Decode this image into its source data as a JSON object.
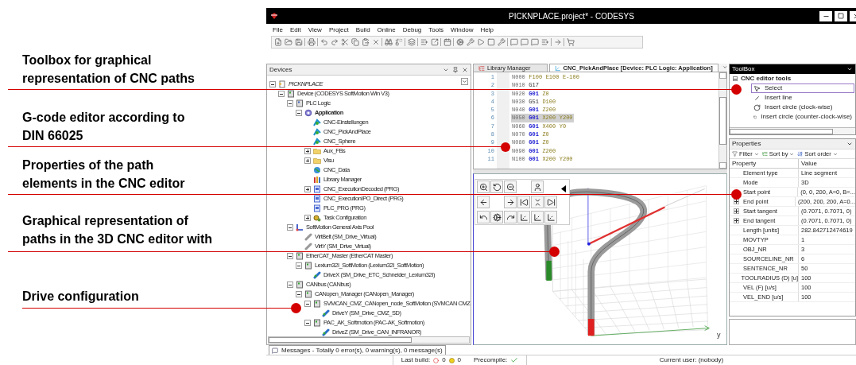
{
  "annotations": [
    {
      "text": "Toolbox for graphical\nrepresentation of CNC paths"
    },
    {
      "text": "G-code editor according to\nDIN 66025"
    },
    {
      "text": "Properties of the path\nelements in the CNC editor"
    },
    {
      "text": "Graphical representation of\npaths in the 3D CNC editor with"
    },
    {
      "text": "Drive configuration"
    }
  ],
  "window": {
    "title": "PICKNPLACE.project* - CODESYS"
  },
  "menu": [
    "File",
    "Edit",
    "View",
    "Project",
    "Build",
    "Online",
    "Debug",
    "Tools",
    "Window",
    "Help"
  ],
  "devices": {
    "title": "Devices",
    "tree": [
      {
        "label": "PICKNPLACE",
        "kind": "project",
        "italic": true,
        "expanded": true,
        "children": [
          {
            "label": "Device (CODESYS SoftMotion Win V3)",
            "kind": "device",
            "expanded": true,
            "children": [
              {
                "label": "PLC Logic",
                "kind": "plc",
                "expanded": true,
                "children": [
                  {
                    "label": "Application",
                    "kind": "app",
                    "bold": true,
                    "expanded": true,
                    "children": [
                      {
                        "label": "CNC-Einstellungen",
                        "kind": "cnc"
                      },
                      {
                        "label": "CNC_PickAndPlace",
                        "kind": "cnc"
                      },
                      {
                        "label": "CNC_Sphere",
                        "kind": "cnc"
                      },
                      {
                        "label": "Aux_FBs",
                        "kind": "folder",
                        "expanded": false
                      },
                      {
                        "label": "Visu",
                        "kind": "folder",
                        "expanded": false
                      },
                      {
                        "label": "CNC_Data",
                        "kind": "globe"
                      },
                      {
                        "label": "Library Manager",
                        "kind": "library"
                      },
                      {
                        "label": "CNC_ExecutionDecoded (PRG)",
                        "kind": "prg",
                        "expanded": false
                      },
                      {
                        "label": "CNC_ExecutionIPO_Direct (PRG)",
                        "kind": "prg"
                      },
                      {
                        "label": "PLC_PRG (PRG)",
                        "kind": "prg"
                      },
                      {
                        "label": "Task Configuration",
                        "kind": "task",
                        "expanded": false
                      }
                    ]
                  }
                ]
              },
              {
                "label": "SoftMotion General Axis Pool",
                "kind": "pool",
                "expanded": true,
                "children": [
                  {
                    "label": "VirtBelt (SM_Drive_Virtual)",
                    "kind": "virtual"
                  },
                  {
                    "label": "VirtY (SM_Drive_Virtual)",
                    "kind": "virtual"
                  }
                ]
              },
              {
                "label": "EtherCAT_Master (EtherCAT Master)",
                "kind": "device",
                "expanded": true,
                "children": [
                  {
                    "label": "Lexium32I_SoftMotion (Lexium32I_SoftMotion)",
                    "kind": "module",
                    "expanded": true,
                    "children": [
                      {
                        "label": "DriveX (SM_Drive_ETC_Schneider_Lexium32I)",
                        "kind": "drive"
                      }
                    ]
                  }
                ]
              },
              {
                "label": "CANbus (CANbus)",
                "kind": "device",
                "expanded": true,
                "children": [
                  {
                    "label": "CANopen_Manager (CANopen_Manager)",
                    "kind": "device",
                    "expanded": true,
                    "children": [
                      {
                        "label": "SVMCAN_CMZ_CANopen_node_SoftMotion (SVMCAN CMZ",
                        "kind": "device",
                        "expanded": true,
                        "children": [
                          {
                            "label": "DriveY (SM_Drive_CMZ_SD)",
                            "kind": "drive"
                          }
                        ]
                      },
                      {
                        "label": "PAC_AK_Softmotion (PAC-AK_Softmotion)",
                        "kind": "device",
                        "expanded": true,
                        "children": [
                          {
                            "label": "DriveZ (SM_Drive_CAN_INFRANOR)",
                            "kind": "drive"
                          }
                        ]
                      }
                    ]
                  }
                ]
              }
            ]
          }
        ]
      }
    ]
  },
  "editor": {
    "tabs": [
      {
        "label": "Library Manager",
        "selected": false
      },
      {
        "label": "CNC_PickAndPlace [Device: PLC Logic: Application]",
        "selected": true
      }
    ],
    "lines": [
      {
        "number": "1",
        "selected": false,
        "tokens": [
          {
            "text": "N000",
            "kind": "block"
          },
          {
            "text": "F100",
            "kind": "coord"
          },
          {
            "text": "E100",
            "kind": "coord"
          },
          {
            "text": "E-100",
            "kind": "coord"
          }
        ]
      },
      {
        "number": "2",
        "selected": false,
        "tokens": [
          {
            "text": "N010",
            "kind": "block"
          },
          {
            "text": "G17",
            "kind": "word"
          }
        ]
      },
      {
        "number": "3",
        "selected": false,
        "tokens": [
          {
            "text": "N020",
            "kind": "block"
          },
          {
            "text": "G01",
            "kind": "gcode"
          },
          {
            "text": "Z0",
            "kind": "coord"
          }
        ]
      },
      {
        "number": "4",
        "selected": false,
        "tokens": [
          {
            "text": "N030",
            "kind": "block"
          },
          {
            "text": "G51",
            "kind": "word"
          },
          {
            "text": "D100",
            "kind": "coord"
          }
        ]
      },
      {
        "number": "5",
        "selected": false,
        "tokens": [
          {
            "text": "N040",
            "kind": "block"
          },
          {
            "text": "G01",
            "kind": "gcode"
          },
          {
            "text": "Z200",
            "kind": "coord"
          }
        ]
      },
      {
        "number": "6",
        "selected": true,
        "tokens": [
          {
            "text": "N050",
            "kind": "block"
          },
          {
            "text": "G01",
            "kind": "gcode"
          },
          {
            "text": "X200",
            "kind": "coord"
          },
          {
            "text": "Y200",
            "kind": "coord"
          }
        ]
      },
      {
        "number": "7",
        "selected": false,
        "tokens": [
          {
            "text": "N060",
            "kind": "block"
          },
          {
            "text": "G01",
            "kind": "gcode"
          },
          {
            "text": "X400",
            "kind": "coord"
          },
          {
            "text": "Y0",
            "kind": "coord"
          }
        ]
      },
      {
        "number": "8",
        "selected": false,
        "tokens": [
          {
            "text": "N070",
            "kind": "block"
          },
          {
            "text": "G01",
            "kind": "gcode"
          },
          {
            "text": "Z0",
            "kind": "coord"
          }
        ]
      },
      {
        "number": "9",
        "selected": false,
        "tokens": [
          {
            "text": "N080",
            "kind": "block"
          },
          {
            "text": "G01",
            "kind": "gcode"
          },
          {
            "text": "Z0",
            "kind": "coord"
          }
        ]
      },
      {
        "number": "10",
        "selected": false,
        "tokens": [
          {
            "text": "N090",
            "kind": "block"
          },
          {
            "text": "G01",
            "kind": "gcode"
          },
          {
            "text": "Z200",
            "kind": "coord"
          }
        ]
      },
      {
        "number": "11",
        "selected": false,
        "tokens": [
          {
            "text": "N100",
            "kind": "block"
          },
          {
            "text": "G01",
            "kind": "gcode"
          },
          {
            "text": "X200",
            "kind": "coord"
          },
          {
            "text": "Y200",
            "kind": "coord"
          }
        ]
      }
    ]
  },
  "view3d": {
    "axis_label": "y"
  },
  "toolbox": {
    "title": "ToolBox",
    "group": "CNC editor tools",
    "items": [
      {
        "label": "Select",
        "kind": "select",
        "selected": true
      },
      {
        "label": "Insert line",
        "kind": "line",
        "selected": false
      },
      {
        "label": "Insert circle (clock-wise)",
        "kind": "cw",
        "selected": false
      },
      {
        "label": "Insert circle (counter-clock-wise)",
        "kind": "ccw",
        "selected": false
      }
    ]
  },
  "properties": {
    "title": "Properties",
    "toolbar": [
      "Filter",
      "Sort by",
      "Sort order"
    ],
    "columns": [
      "Property",
      "Value"
    ],
    "rows": [
      {
        "name": "Element type",
        "value": "Line segment",
        "expandable": false
      },
      {
        "name": "Mode",
        "value": "3D",
        "expandable": false
      },
      {
        "name": "Start point",
        "value": "(0, 0, 200, A=0, B=...",
        "expandable": false
      },
      {
        "name": "End point",
        "value": "(200, 200, 200, A=0...",
        "expandable": true
      },
      {
        "name": "Start tangent",
        "value": "(0.7071, 0.7071, 0)",
        "expandable": true
      },
      {
        "name": "End tangent",
        "value": "(0.7071, 0.7071, 0)",
        "expandable": true
      },
      {
        "name": "Length [units]",
        "value": "282.842712474619",
        "expandable": false
      },
      {
        "name": "MOVTYP",
        "value": "1",
        "expandable": false
      },
      {
        "name": "OBJ_NR",
        "value": "3",
        "expandable": false
      },
      {
        "name": "SOURCELINE_NR",
        "value": "6",
        "expandable": false
      },
      {
        "name": "SENTENCE_NR",
        "value": "50",
        "expandable": false
      },
      {
        "name": "TOOLRADIUS (D) [u]",
        "value": "100",
        "expandable": false
      },
      {
        "name": "VEL (F) [u/s]",
        "value": "100",
        "expandable": false
      },
      {
        "name": "VEL_END [u/s]",
        "value": "100",
        "expandable": false
      }
    ]
  },
  "messages": {
    "label": "Messages - Totally 0 error(s), 0 warning(s), 0 message(s)"
  },
  "status_bar": {
    "last_build": "Last build:",
    "errors": "0",
    "warnings": "0",
    "precompile": "Precompile:",
    "precompile_ok": true,
    "user": "Current user: (nobody)"
  }
}
